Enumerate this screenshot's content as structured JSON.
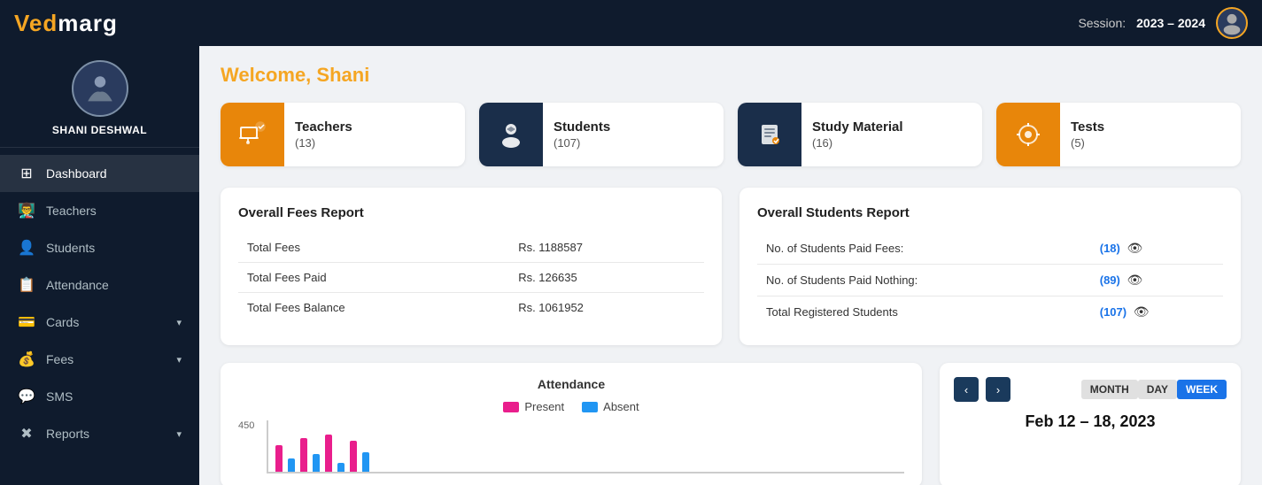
{
  "header": {
    "logo_prefix": "Ved",
    "logo_suffix": "marg",
    "session_label": "Session:",
    "session_value": "2023 – 2024"
  },
  "sidebar": {
    "user_name": "SHANI DESHWAL",
    "nav_items": [
      {
        "id": "dashboard",
        "label": "Dashboard",
        "icon": "⊞",
        "active": true,
        "has_chevron": false
      },
      {
        "id": "teachers",
        "label": "Teachers",
        "icon": "👨‍🏫",
        "active": false,
        "has_chevron": false
      },
      {
        "id": "students",
        "label": "Students",
        "icon": "👤",
        "active": false,
        "has_chevron": false
      },
      {
        "id": "attendance",
        "label": "Attendance",
        "icon": "📋",
        "active": false,
        "has_chevron": false
      },
      {
        "id": "cards",
        "label": "Cards",
        "icon": "💳",
        "active": false,
        "has_chevron": true
      },
      {
        "id": "fees",
        "label": "Fees",
        "icon": "💰",
        "active": false,
        "has_chevron": true
      },
      {
        "id": "sms",
        "label": "SMS",
        "icon": "💬",
        "active": false,
        "has_chevron": false
      },
      {
        "id": "reports",
        "label": "Reports",
        "icon": "✖",
        "active": false,
        "has_chevron": true
      }
    ]
  },
  "main": {
    "welcome_prefix": "Welcome, ",
    "welcome_name": "Shani",
    "stats": [
      {
        "id": "teachers",
        "label": "Teachers",
        "count": "(13)",
        "icon": "🎓",
        "icon_style": "orange-dark"
      },
      {
        "id": "students",
        "label": "Students",
        "count": "(107)",
        "icon": "👨‍🎓",
        "icon_style": "navy"
      },
      {
        "id": "study_material",
        "label": "Study Material",
        "count": "(16)",
        "icon": "📖",
        "icon_style": "navy2"
      },
      {
        "id": "tests",
        "label": "Tests",
        "count": "(5)",
        "icon": "⚙",
        "icon_style": "orange2"
      }
    ],
    "fees_report": {
      "title": "Overall Fees Report",
      "rows": [
        {
          "label": "Total Fees",
          "value": "Rs. 1188587"
        },
        {
          "label": "Total Fees Paid",
          "value": "Rs. 126635"
        },
        {
          "label": "Total Fees Balance",
          "value": "Rs. 1061952"
        }
      ]
    },
    "students_report": {
      "title": "Overall Students Report",
      "rows": [
        {
          "label": "No. of Students Paid Fees:",
          "value": "(18)",
          "has_eye": true
        },
        {
          "label": "No. of Students Paid Nothing:",
          "value": "(89)",
          "has_eye": true
        },
        {
          "label": "Total Registered Students",
          "value": "(107)",
          "has_eye": true
        }
      ]
    },
    "attendance": {
      "title": "Attendance",
      "legend_present": "Present",
      "legend_absent": "Absent",
      "y_label": "450"
    },
    "calendar": {
      "date_range": "Feb 12 – 18, 2023",
      "view_buttons": [
        "MONTH",
        "DAY",
        "WEEK"
      ],
      "active_view": "WEEK"
    }
  }
}
